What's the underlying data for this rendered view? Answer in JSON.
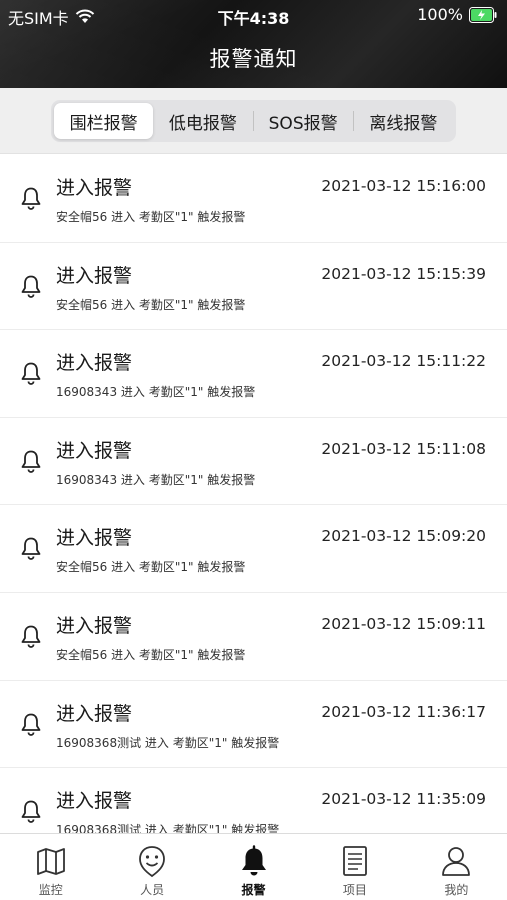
{
  "status_bar": {
    "carrier": "无SIM卡",
    "time": "下午4:38",
    "battery": "100%"
  },
  "header": {
    "title": "报警通知"
  },
  "tabs": [
    "围栏报警",
    "低电报警",
    "SOS报警",
    "离线报警"
  ],
  "alarms": [
    {
      "title": "进入报警",
      "time": "2021-03-12 15:16:00",
      "desc": "安全帽56 进入 考勤区\"1\" 触发报警"
    },
    {
      "title": "进入报警",
      "time": "2021-03-12 15:15:39",
      "desc": "安全帽56 进入 考勤区\"1\" 触发报警"
    },
    {
      "title": "进入报警",
      "time": "2021-03-12 15:11:22",
      "desc": "16908343 进入 考勤区\"1\" 触发报警"
    },
    {
      "title": "进入报警",
      "time": "2021-03-12 15:11:08",
      "desc": "16908343 进入 考勤区\"1\" 触发报警"
    },
    {
      "title": "进入报警",
      "time": "2021-03-12 15:09:20",
      "desc": "安全帽56 进入 考勤区\"1\" 触发报警"
    },
    {
      "title": "进入报警",
      "time": "2021-03-12 15:09:11",
      "desc": "安全帽56 进入 考勤区\"1\" 触发报警"
    },
    {
      "title": "进入报警",
      "time": "2021-03-12 11:36:17",
      "desc": "16908368测试 进入 考勤区\"1\" 触发报警"
    },
    {
      "title": "进入报警",
      "time": "2021-03-12 11:35:09",
      "desc": "16908368测试 进入 考勤区\"1\" 触发报警"
    }
  ],
  "tabbar": [
    {
      "label": "监控",
      "icon": "map-icon"
    },
    {
      "label": "人员",
      "icon": "person-smile-icon"
    },
    {
      "label": "报警",
      "icon": "bell-icon"
    },
    {
      "label": "项目",
      "icon": "document-list-icon"
    },
    {
      "label": "我的",
      "icon": "user-profile-icon"
    }
  ],
  "colors": {
    "header_bg": "#1c1c1c",
    "battery_fill": "#4cd964",
    "active": "#111111"
  }
}
